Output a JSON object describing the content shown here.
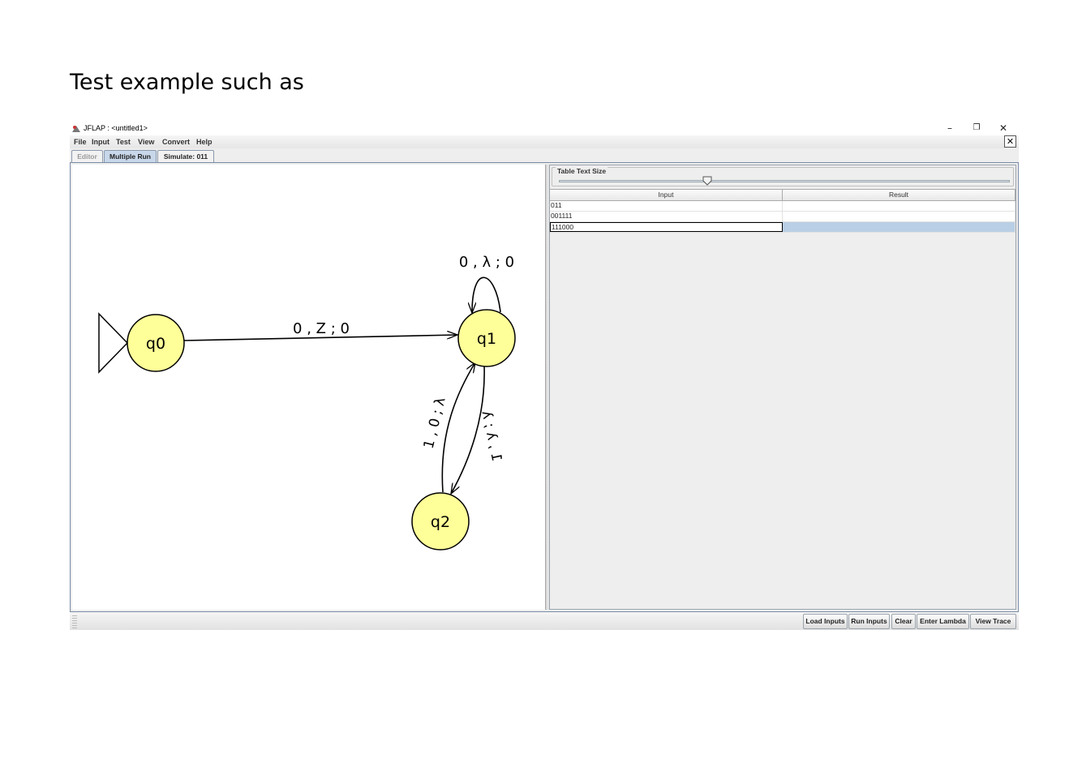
{
  "slide": {
    "heading": "Test example such as"
  },
  "window": {
    "title": "JFLAP : <untitled1>",
    "minimize_glyph": "–",
    "restore_glyph": "❐",
    "close_glyph": "✕",
    "doc_close_glyph": "✕"
  },
  "menu": {
    "file": "File",
    "input": "Input",
    "test": "Test",
    "view": "View",
    "convert": "Convert",
    "help": "Help"
  },
  "tabs": {
    "editor": "Editor",
    "multiple_run": "Multiple Run",
    "simulate": "Simulate: 011"
  },
  "automaton": {
    "states": {
      "q0": "q0",
      "q1": "q1",
      "q2": "q2"
    },
    "transitions": {
      "q0_q1": "0 , Z ; 0",
      "q1_loop": "0 , λ ; 0",
      "q2_q1": "1 , 0 ; λ",
      "q1_q2": "1 , λ ; λ"
    }
  },
  "panel": {
    "slider_label": "Table Text Size",
    "slider_level": 0.33,
    "table": {
      "headers": {
        "input": "Input",
        "result": "Result"
      },
      "rows": [
        {
          "input": "011",
          "result": ""
        },
        {
          "input": "001111",
          "result": ""
        },
        {
          "input": "111000",
          "result": ""
        }
      ]
    }
  },
  "buttons": {
    "load_inputs": "Load Inputs",
    "run_inputs": "Run Inputs",
    "clear": "Clear",
    "enter_lambda": "Enter Lambda",
    "view_trace": "View Trace"
  },
  "colors": {
    "state_fill": "#ffff99",
    "selection": "#b9cfe5",
    "tab_active": "#c8d8ea"
  }
}
